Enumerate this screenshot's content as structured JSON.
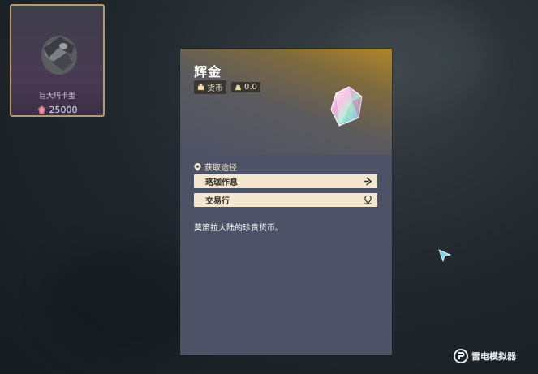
{
  "item_card": {
    "name": "巨大玛卡蛋",
    "price": "25000"
  },
  "panel": {
    "title": "辉金",
    "category": "货币",
    "weight": "0.0",
    "source_heading": "获取途径",
    "sources": [
      {
        "label": "珞珈作息",
        "icon": "arrow-go-icon"
      },
      {
        "label": "交易行",
        "icon": "map-pin-icon"
      }
    ],
    "description": "莫笛拉大陆的珍贵货币。"
  },
  "watermark": {
    "text": "雷电模拟器"
  },
  "colors": {
    "panel_bg": "#4e5266",
    "header_gold": "#b0862a",
    "button_bg": "#f3e7cf",
    "card_border": "#b79a72"
  }
}
